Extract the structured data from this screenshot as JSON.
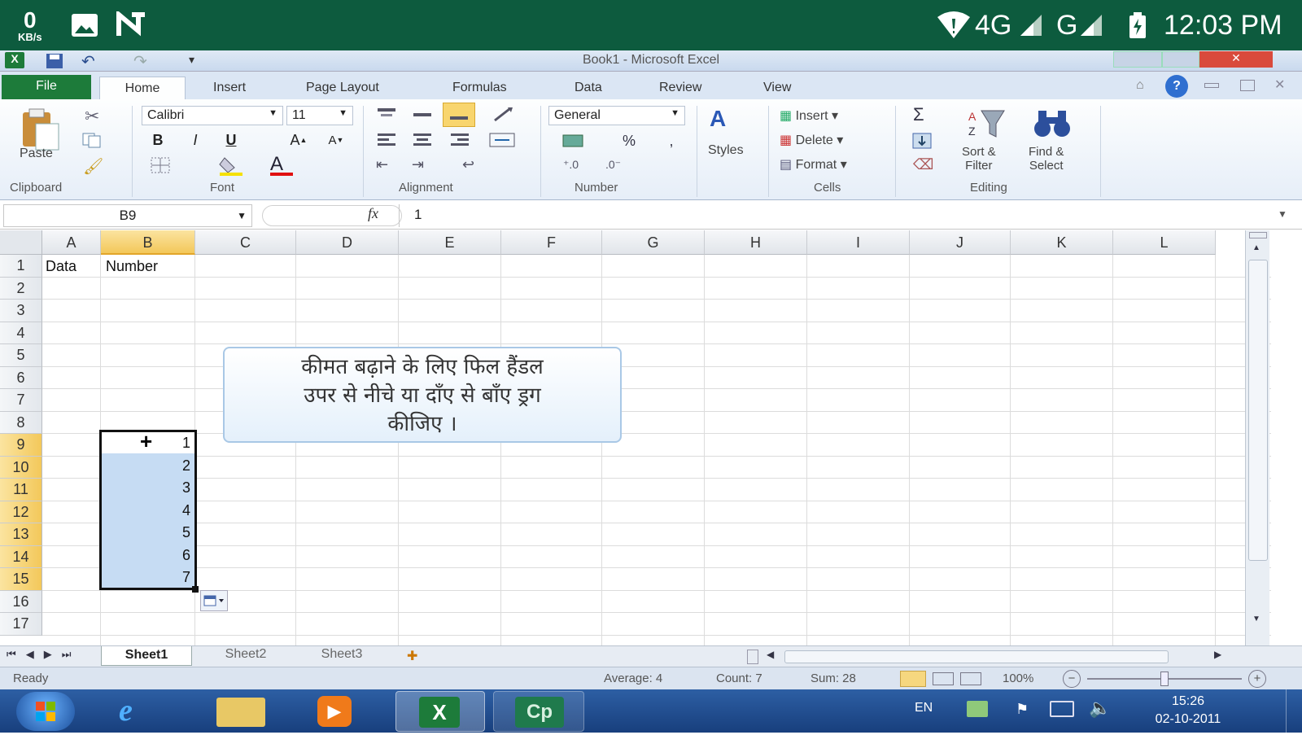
{
  "phone_status": {
    "speed_value": "0",
    "speed_unit": "KB/s",
    "network_1": "4G",
    "network_2": "G",
    "time": "12:03 PM"
  },
  "window": {
    "title": "Book1 - Microsoft Excel"
  },
  "ribbon_tabs": [
    "File",
    "Home",
    "Insert",
    "Page Layout",
    "Formulas",
    "Data",
    "Review",
    "View"
  ],
  "ribbon": {
    "paste_label": "Paste",
    "clipboard_group": "Clipboard",
    "font_name": "Calibri",
    "font_size": "11",
    "font_group": "Font",
    "alignment_group": "Alignment",
    "number_format": "General",
    "number_group": "Number",
    "styles_label": "Styles",
    "insert_label": "Insert",
    "delete_label": "Delete",
    "format_label": "Format",
    "cells_group": "Cells",
    "sort_filter_label_1": "Sort &",
    "sort_filter_label_2": "Filter",
    "find_select_label_1": "Find &",
    "find_select_label_2": "Select",
    "editing_group": "Editing",
    "bold": "B",
    "italic": "I",
    "underline": "U",
    "percent": "%"
  },
  "formula_bar": {
    "name_box": "B9",
    "fx": "fx",
    "value": "1"
  },
  "columns": [
    "A",
    "B",
    "C",
    "D",
    "E",
    "F",
    "G",
    "H",
    "I",
    "J",
    "K",
    "L"
  ],
  "rows": [
    "1",
    "2",
    "3",
    "4",
    "5",
    "6",
    "7",
    "8",
    "9",
    "10",
    "11",
    "12",
    "13",
    "14",
    "15",
    "16",
    "17"
  ],
  "cells": {
    "A1": "Data",
    "B1": "Number",
    "B9": "1",
    "B10": "2",
    "B11": "3",
    "B12": "4",
    "B13": "5",
    "B14": "6",
    "B15": "7"
  },
  "callout": {
    "line1": "कीमत बढ़ाने के लिए फिल हैंडल",
    "line2": "उपर से नीचे या दाँए से बाँए ड्रग",
    "line3": "कीजिए ।"
  },
  "sheet_tabs": [
    "Sheet1",
    "Sheet2",
    "Sheet3"
  ],
  "status_bar": {
    "ready": "Ready",
    "average": "Average: 4",
    "count": "Count: 7",
    "sum": "Sum: 28",
    "zoom": "100%"
  },
  "taskbar": {
    "language": "EN",
    "clock_time": "15:26",
    "clock_date": "02-10-2011",
    "cp_label": "Cp"
  },
  "colors": {
    "phone_bar": "#0d5b3e",
    "file_tab": "#1d7b3a",
    "selection": "#c6dcf3",
    "header_highlight": "#f6d77f",
    "taskbar": "#1f4c8f"
  }
}
